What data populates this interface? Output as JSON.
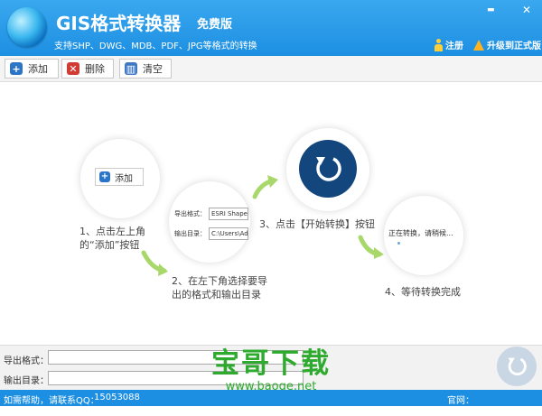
{
  "header": {
    "title": "GIS格式转换器",
    "edition": "免费版",
    "subtitle": "支持SHP、DWG、MDB、PDF、JPG等格式的转换",
    "register": "注册",
    "upgrade": "升级到正式版",
    "min_glyph": "▬",
    "close_glyph": "✕"
  },
  "toolbar": {
    "add": "添加",
    "delete": "删除",
    "clear": "清空"
  },
  "guide": {
    "mini_add": "添加",
    "step1_line1": "1、点击左上角",
    "step1_line2": "的“添加”按钮",
    "mini_export_label": "导出格式：",
    "mini_export_value": "ESRI Shapefile",
    "mini_output_label": "输出目录：",
    "mini_output_value": "C:\\Users\\Adm",
    "step2_line1": "2、在左下角选择要导",
    "step2_line2": "出的格式和输出目录",
    "step3": "3、点击【开始转换】按钮",
    "converting": "正在转换，请稍候...",
    "step4": "4、等待转换完成"
  },
  "bottom": {
    "export_label": "导出格式：",
    "output_label": "输出目录："
  },
  "watermark": {
    "line1": "宝哥下载",
    "line2": "www.baoge.net"
  },
  "status": {
    "help": "如需帮助，请联系QQ：",
    "qq": "15053088",
    "site": "官网：www.gissaas.com"
  },
  "colors": {
    "header_blue": "#1d8fe2",
    "start_button": "#14467e",
    "arrow_green": "#a8d86a"
  }
}
